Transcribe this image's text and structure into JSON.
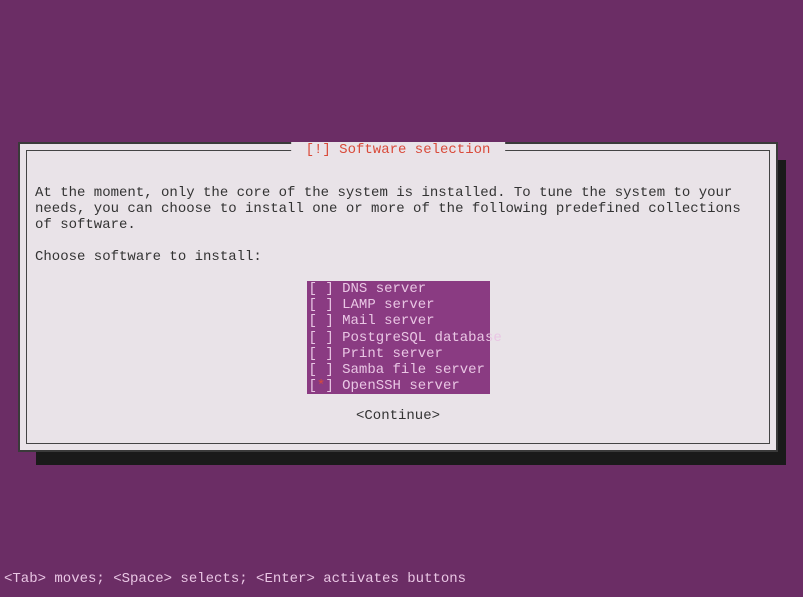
{
  "dialog": {
    "title": "[!] Software selection",
    "body": "At the moment, only the core of the system is installed. To tune the system to your needs, you can choose to install one or more of the following predefined collections of software.",
    "prompt": "Choose software to install:",
    "options": [
      {
        "label": "DNS server",
        "selected": false
      },
      {
        "label": "LAMP server",
        "selected": false
      },
      {
        "label": "Mail server",
        "selected": false
      },
      {
        "label": "PostgreSQL database",
        "selected": false
      },
      {
        "label": "Print server",
        "selected": false
      },
      {
        "label": "Samba file server",
        "selected": false
      },
      {
        "label": "OpenSSH server",
        "selected": true
      }
    ],
    "continue_label": "<Continue>"
  },
  "footer_hint": "<Tab> moves; <Space> selects; <Enter> activates buttons"
}
